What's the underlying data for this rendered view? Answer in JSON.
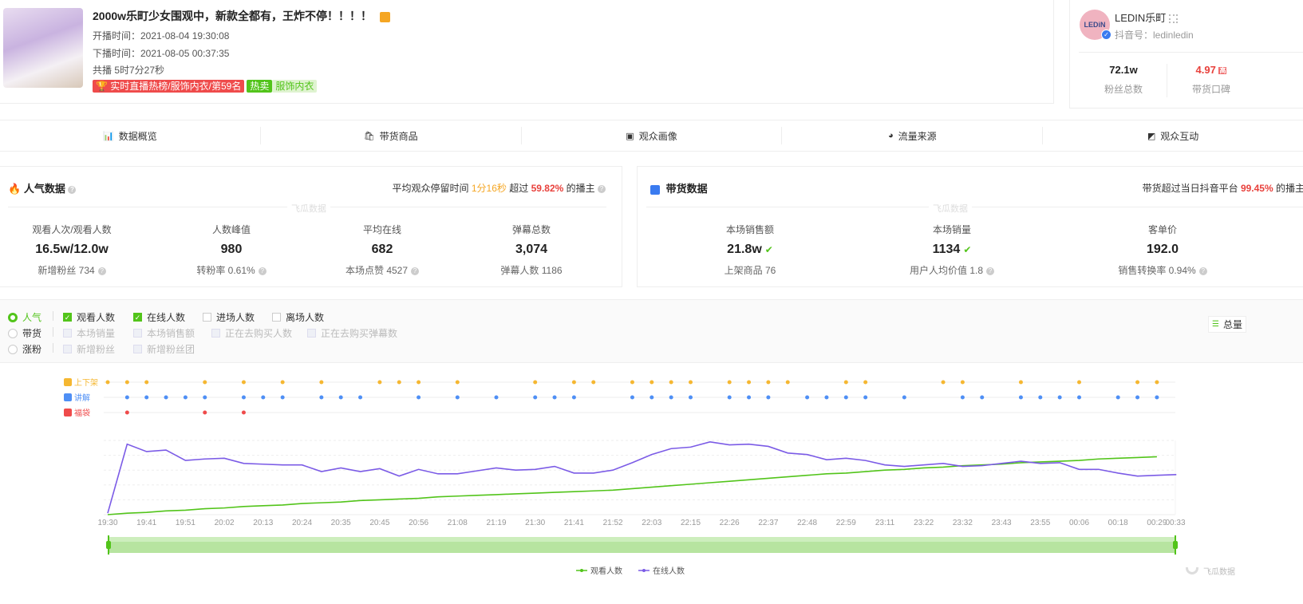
{
  "live": {
    "title": "2000w乐町少女围观中，新款全都有，王炸不停！！！！",
    "start": "开播时间：2021-08-04 19:30:08",
    "end": "下播时间：2021-08-05 00:37:35",
    "duration": "共播 5时7分27秒",
    "rank_tag": "实时直播热榜/服饰内衣/第59名",
    "hot_tag": "热卖",
    "category_tag": "服饰内衣"
  },
  "anchor": {
    "name": "LEDIN乐町",
    "douyin_id": "抖音号：ledinledin",
    "avatar_text": "LEDiN",
    "fans": "72.1w",
    "fans_label": "粉丝总数",
    "rating": "4.97",
    "rating_badge": "高",
    "rating_label": "带货口碑"
  },
  "tabs": [
    {
      "label": "数据概览",
      "icon": "bar-chart-icon"
    },
    {
      "label": "带货商品",
      "icon": "bag-icon"
    },
    {
      "label": "观众画像",
      "icon": "portrait-icon"
    },
    {
      "label": "流量来源",
      "icon": "source-icon"
    },
    {
      "label": "观众互动",
      "icon": "interaction-icon"
    }
  ],
  "popularity": {
    "title": "人气数据",
    "summary_pre": "平均观众停留时间",
    "stay": "1分16秒",
    "summary_mid": "超过",
    "pct": "59.82%",
    "summary_post": "的播主",
    "watermark": "飞瓜数据",
    "stats": [
      {
        "label": "观看人次/观看人数",
        "value": "16.5w/12.0w",
        "sub": "新增粉丝 734"
      },
      {
        "label": "人数峰值",
        "value": "980",
        "sub": "转粉率 0.61%"
      },
      {
        "label": "平均在线",
        "value": "682",
        "sub": "本场点赞 4527"
      },
      {
        "label": "弹幕总数",
        "value": "3,074",
        "sub": "弹幕人数 1186"
      }
    ]
  },
  "sales": {
    "title": "带货数据",
    "summary_pre": "带货超过当日抖音平台",
    "pct": "99.45%",
    "summary_post": "的播主",
    "watermark": "飞瓜数据",
    "stats": [
      {
        "label": "本场销售额",
        "value": "21.8w",
        "sub": "上架商品 76"
      },
      {
        "label": "本场销量",
        "value": "1134",
        "sub": "用户人均价值 1.8"
      },
      {
        "label": "客单价",
        "value": "192.0",
        "sub": "销售转换率 0.94%"
      }
    ]
  },
  "controls": {
    "modes": [
      {
        "label": "人气",
        "on": true
      },
      {
        "label": "带货",
        "on": false
      },
      {
        "label": "涨粉",
        "on": false
      }
    ],
    "row1": [
      {
        "label": "观看人数",
        "state": "on"
      },
      {
        "label": "在线人数",
        "state": "on"
      },
      {
        "label": "进场人数",
        "state": "off"
      },
      {
        "label": "离场人数",
        "state": "off"
      }
    ],
    "row2": [
      {
        "label": "本场销量"
      },
      {
        "label": "本场销售额"
      },
      {
        "label": "正在去购买人数"
      },
      {
        "label": "正在去购买弹幕数"
      }
    ],
    "row3": [
      {
        "label": "新增粉丝"
      },
      {
        "label": "新增粉丝团"
      }
    ],
    "total_label": "总量"
  },
  "chart_data": {
    "type": "line",
    "events": [
      {
        "name": "上下架",
        "color": "#f5b731",
        "idx": [
          0,
          1,
          2,
          5,
          7,
          9,
          11,
          14,
          15,
          16,
          18,
          22,
          24,
          25,
          27,
          28,
          29,
          30,
          32,
          33,
          34,
          35,
          38,
          39,
          43,
          44,
          47,
          50,
          53,
          54
        ]
      },
      {
        "name": "讲解",
        "color": "#4e8ff5",
        "idx": [
          1,
          2,
          3,
          4,
          5,
          7,
          8,
          9,
          11,
          12,
          13,
          16,
          18,
          20,
          22,
          23,
          24,
          27,
          28,
          29,
          30,
          32,
          33,
          34,
          36,
          37,
          38,
          39,
          41,
          44,
          45,
          47,
          48,
          49,
          50,
          52,
          53,
          54
        ]
      },
      {
        "name": "福袋",
        "color": "#ef4b4b",
        "idx": [
          1,
          5,
          7
        ]
      }
    ],
    "x_labels": [
      "19:30",
      "19:41",
      "19:51",
      "20:02",
      "20:13",
      "20:24",
      "20:35",
      "20:45",
      "20:56",
      "21:08",
      "21:19",
      "21:30",
      "21:41",
      "21:52",
      "22:03",
      "22:15",
      "22:26",
      "22:37",
      "22:48",
      "22:59",
      "23:11",
      "23:22",
      "23:32",
      "23:43",
      "23:55",
      "00:06",
      "00:18",
      "00:29",
      "00:33"
    ],
    "series": [
      {
        "name": "观看人数",
        "color": "#52c41a",
        "values": [
          0,
          2,
          3,
          5,
          6,
          8,
          9,
          11,
          12,
          13,
          15,
          16,
          17,
          19,
          20,
          21,
          22,
          24,
          25,
          26,
          27,
          28,
          29,
          30,
          31,
          32,
          33,
          35,
          37,
          39,
          41,
          43,
          45,
          47,
          49,
          51,
          53,
          55,
          56,
          58,
          60,
          61,
          63,
          64,
          66,
          67,
          68,
          70,
          71,
          72,
          73,
          75,
          76,
          77,
          78
        ]
      },
      {
        "name": "在线人数",
        "color": "#7b5be6",
        "values": [
          2,
          95,
          85,
          87,
          73,
          75,
          76,
          69,
          68,
          67,
          67,
          58,
          63,
          58,
          62,
          52,
          61,
          55,
          55,
          59,
          63,
          60,
          61,
          65,
          56,
          56,
          60,
          70,
          81,
          89,
          91,
          98,
          94,
          95,
          92,
          83,
          81,
          74,
          76,
          73,
          67,
          65,
          67,
          69,
          65,
          66,
          69,
          72,
          69,
          70,
          61,
          61,
          56,
          52,
          53,
          54
        ]
      }
    ],
    "ylim": [
      0,
      100
    ],
    "grid": true,
    "legend": "bottom"
  },
  "watermark": "飞瓜数据"
}
